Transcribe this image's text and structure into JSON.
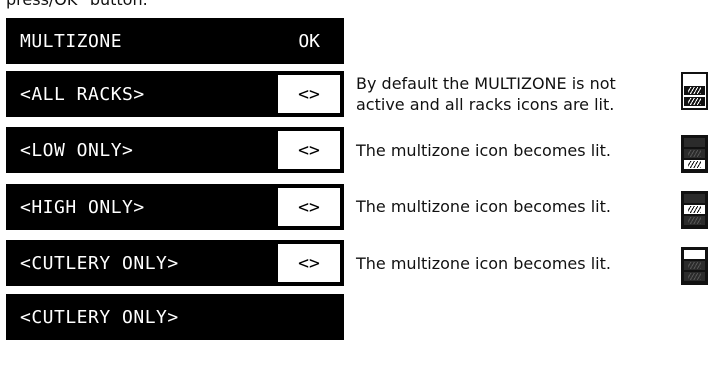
{
  "fragment_text": "press/OK\" button.",
  "panels": [
    {
      "label": "MULTIZONE",
      "right": "OK"
    },
    {
      "label": "<ALL RACKS>",
      "right": "<>"
    },
    {
      "label": "<LOW ONLY>",
      "right": "<>"
    },
    {
      "label": "<HIGH ONLY>",
      "right": "<>"
    },
    {
      "label": "<CUTLERY ONLY>",
      "right": "<>"
    },
    {
      "label": "<CUTLERY ONLY>",
      "right": ""
    }
  ],
  "descriptions": [
    {
      "line1": "By default the MULTIZONE is not",
      "line2": "active and all racks icons are lit."
    },
    {
      "line1": "The multizone icon becomes lit."
    },
    {
      "line1": "The multizone icon becomes lit."
    },
    {
      "line1": "The multizone icon becomes lit."
    }
  ],
  "icons": [
    {
      "name": "all-racks-icon",
      "top": "off",
      "mid": "lit",
      "bot": "lit"
    },
    {
      "name": "low-only-icon",
      "top": "dim",
      "mid": "dim",
      "bot": "lit"
    },
    {
      "name": "high-only-icon",
      "top": "dim",
      "mid": "lit",
      "bot": "dim"
    },
    {
      "name": "cutlery-only-icon",
      "top": "lit",
      "mid": "dim",
      "bot": "dim"
    }
  ]
}
